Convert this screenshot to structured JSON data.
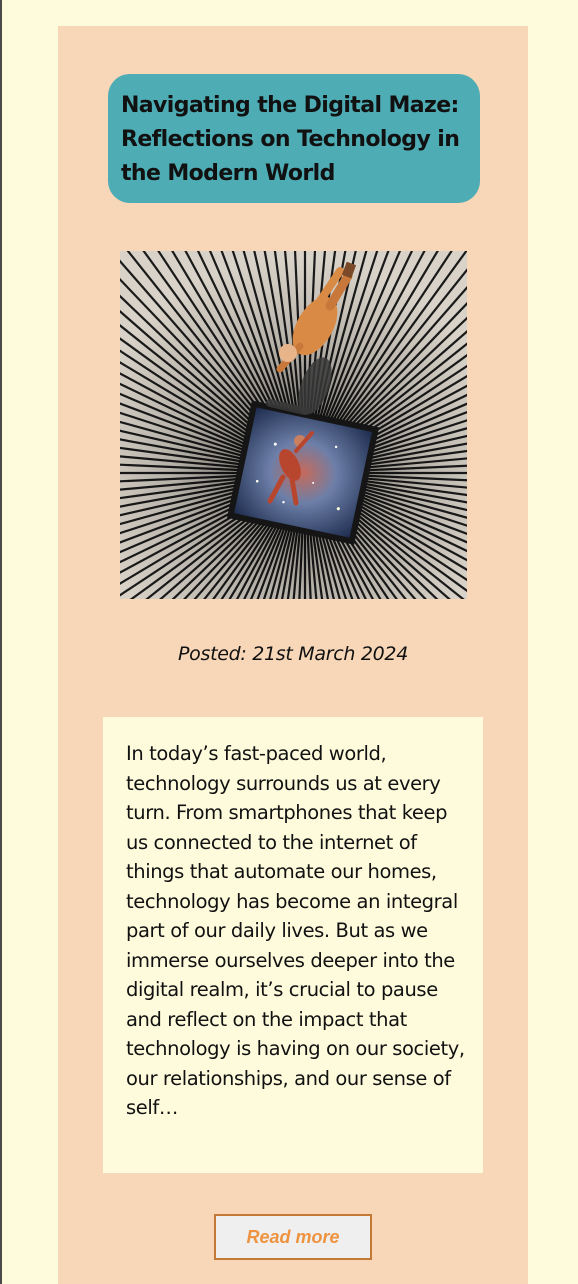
{
  "post": {
    "title": "Navigating the Digital Maze: Reflections on Technology in the Modern World",
    "image_alt": "Surreal collage of figures falling into a striped square tunnel opening onto a starry nebula",
    "date": "Posted: 21st March 2024",
    "excerpt": "In today’s fast-paced world, technology surrounds us at every turn. From smartphones that keep us connected to the internet of things that automate our homes, technology has become an integral part of our daily lives. But as we immerse ourselves deeper into the digital realm, it’s crucial to pause and reflect on the impact that technology is having on our society, our relationships, and our sense of self…",
    "read_more_label": "Read more"
  },
  "colors": {
    "page_background": "#FEFBDD",
    "card_background": "#F7D7B8",
    "title_background": "#4EACB4",
    "excerpt_background": "#FEFBDD",
    "button_text": "#EE9340",
    "button_border": "#C47A34"
  }
}
